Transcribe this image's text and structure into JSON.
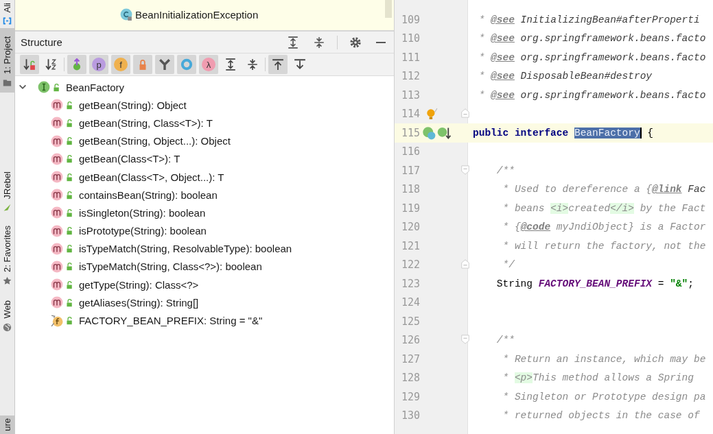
{
  "tool_strip": {
    "tabs": [
      {
        "label": "Ali",
        "kind": "ali",
        "selected": false
      },
      {
        "label": "1: Project",
        "kind": "project",
        "selected": true
      },
      {
        "label": "JRebel",
        "kind": "jrebel",
        "selected": false
      },
      {
        "label": "2: Favorites",
        "kind": "favorites",
        "selected": false
      },
      {
        "label": "Web",
        "kind": "web",
        "selected": false
      },
      {
        "label": "ure",
        "kind": "structure",
        "selected": true
      }
    ]
  },
  "project_tree": {
    "items": [
      {
        "label": "BeanInitializationException",
        "kind": "class"
      }
    ]
  },
  "structure": {
    "title": "Structure",
    "toolbar": [
      {
        "kind": "sort-visibility",
        "selected": true
      },
      {
        "kind": "sort-alpha",
        "selected": false
      },
      {
        "kind": "separator"
      },
      {
        "kind": "inherited",
        "selected": true
      },
      {
        "kind": "glyph",
        "glyph": "p",
        "color": "#b99bdf",
        "selected": true
      },
      {
        "kind": "glyph",
        "glyph": "f",
        "color": "#efb14f",
        "selected": true
      },
      {
        "kind": "lock",
        "selected": true
      },
      {
        "kind": "anonymous",
        "selected": true
      },
      {
        "kind": "ring",
        "selected": true
      },
      {
        "kind": "glyph",
        "glyph": "λ",
        "color": "#f09cb0",
        "selected": true
      },
      {
        "kind": "expand",
        "selected": false
      },
      {
        "kind": "collapse",
        "selected": false
      },
      {
        "kind": "separator"
      },
      {
        "kind": "scroll-to",
        "selected": true
      },
      {
        "kind": "scroll-from",
        "selected": false
      }
    ],
    "tree": {
      "label": "BeanFactory",
      "kind": "interface",
      "expanded": true,
      "children": [
        {
          "label": "getBean(String): Object",
          "kind": "method"
        },
        {
          "label": "getBean(String, Class<T>): T",
          "kind": "method"
        },
        {
          "label": "getBean(String, Object...): Object",
          "kind": "method"
        },
        {
          "label": "getBean(Class<T>): T",
          "kind": "method"
        },
        {
          "label": "getBean(Class<T>, Object...): T",
          "kind": "method"
        },
        {
          "label": "containsBean(String): boolean",
          "kind": "method"
        },
        {
          "label": "isSingleton(String): boolean",
          "kind": "method"
        },
        {
          "label": "isPrototype(String): boolean",
          "kind": "method"
        },
        {
          "label": "isTypeMatch(String, ResolvableType): boolean",
          "kind": "method"
        },
        {
          "label": "isTypeMatch(String, Class<?>): boolean",
          "kind": "method"
        },
        {
          "label": "getType(String): Class<?>",
          "kind": "method"
        },
        {
          "label": "getAliases(String): String[]",
          "kind": "method"
        },
        {
          "label": "FACTORY_BEAN_PREFIX: String = \"&\"",
          "kind": "field"
        }
      ]
    }
  },
  "editor": {
    "lines": [
      {
        "number": "109",
        "current": false,
        "segments": [
          {
            "kind": "comment",
            "text": " * "
          },
          {
            "kind": "doctag",
            "text": "@see"
          },
          {
            "kind": "docref",
            "text": " InitializingBean#afterProperti"
          }
        ]
      },
      {
        "number": "110",
        "current": false,
        "segments": [
          {
            "kind": "comment",
            "text": " * "
          },
          {
            "kind": "doctag",
            "text": "@see"
          },
          {
            "kind": "docref",
            "text": " org.springframework.beans.facto"
          }
        ]
      },
      {
        "number": "111",
        "current": false,
        "segments": [
          {
            "kind": "comment",
            "text": " * "
          },
          {
            "kind": "doctag",
            "text": "@see"
          },
          {
            "kind": "docref",
            "text": " org.springframework.beans.facto"
          }
        ]
      },
      {
        "number": "112",
        "current": false,
        "segments": [
          {
            "kind": "comment",
            "text": " * "
          },
          {
            "kind": "doctag",
            "text": "@see"
          },
          {
            "kind": "docref",
            "text": " DisposableBean#destroy"
          }
        ]
      },
      {
        "number": "113",
        "current": false,
        "segments": [
          {
            "kind": "comment",
            "text": " * "
          },
          {
            "kind": "doctag",
            "text": "@see"
          },
          {
            "kind": "docref",
            "text": " org.springframework.beans.facto"
          }
        ]
      },
      {
        "number": "114",
        "current": false,
        "gutter_marks": [
          {
            "kind": "bulb"
          },
          {
            "kind": "fold-end"
          }
        ]
      },
      {
        "number": "115",
        "current": true,
        "gutter_marks": [
          {
            "kind": "implemented"
          }
        ],
        "segments": [
          {
            "kind": "keyword",
            "text": "public interface "
          },
          {
            "kind": "selected",
            "text": "BeanFactory"
          },
          {
            "kind": "plain",
            "text": " {"
          }
        ]
      },
      {
        "number": "116",
        "current": false
      },
      {
        "number": "117",
        "current": false,
        "gutter_marks": [
          {
            "kind": "fold-start"
          }
        ],
        "segments": [
          {
            "kind": "comment",
            "text": "    /**"
          }
        ]
      },
      {
        "number": "118",
        "current": false,
        "segments": [
          {
            "kind": "comment",
            "text": "     * Used to dereference a {"
          },
          {
            "kind": "doctag",
            "text": "@link"
          },
          {
            "kind": "docref",
            "text": " Fac"
          }
        ]
      },
      {
        "number": "119",
        "current": false,
        "segments": [
          {
            "kind": "comment",
            "text": "     * beans "
          },
          {
            "kind": "htmltag",
            "text": "<i>"
          },
          {
            "kind": "comment",
            "text": "created"
          },
          {
            "kind": "htmltag",
            "text": "</i>"
          },
          {
            "kind": "comment",
            "text": " by the Fact"
          }
        ]
      },
      {
        "number": "120",
        "current": false,
        "segments": [
          {
            "kind": "comment",
            "text": "     * {"
          },
          {
            "kind": "doctag",
            "text": "@code"
          },
          {
            "kind": "comment",
            "text": " myJndiObject} is a Factor"
          }
        ]
      },
      {
        "number": "121",
        "current": false,
        "segments": [
          {
            "kind": "comment",
            "text": "     * will return the factory, not the"
          }
        ]
      },
      {
        "number": "122",
        "current": false,
        "gutter_marks": [
          {
            "kind": "fold-end"
          }
        ],
        "segments": [
          {
            "kind": "comment",
            "text": "     */"
          }
        ]
      },
      {
        "number": "123",
        "current": false,
        "segments": [
          {
            "kind": "plain",
            "text": "    String "
          },
          {
            "kind": "field",
            "text": "FACTORY_BEAN_PREFIX"
          },
          {
            "kind": "plain",
            "text": " = "
          },
          {
            "kind": "string",
            "text": "\"&\""
          },
          {
            "kind": "plain",
            "text": ";"
          }
        ]
      },
      {
        "number": "124",
        "current": false
      },
      {
        "number": "125",
        "current": false
      },
      {
        "number": "126",
        "current": false,
        "gutter_marks": [
          {
            "kind": "fold-start"
          }
        ],
        "segments": [
          {
            "kind": "comment",
            "text": "    /**"
          }
        ]
      },
      {
        "number": "127",
        "current": false,
        "segments": [
          {
            "kind": "comment",
            "text": "     * Return an instance, which may be"
          }
        ]
      },
      {
        "number": "128",
        "current": false,
        "segments": [
          {
            "kind": "comment",
            "text": "     * "
          },
          {
            "kind": "htmltag",
            "text": "<p>"
          },
          {
            "kind": "comment",
            "text": "This method allows a Spring"
          }
        ]
      },
      {
        "number": "129",
        "current": false,
        "segments": [
          {
            "kind": "comment",
            "text": "     * Singleton or Prototype design pa"
          }
        ]
      },
      {
        "number": "130",
        "current": false,
        "segments": [
          {
            "kind": "comment",
            "text": "     * returned objects in the case of"
          }
        ]
      }
    ]
  }
}
